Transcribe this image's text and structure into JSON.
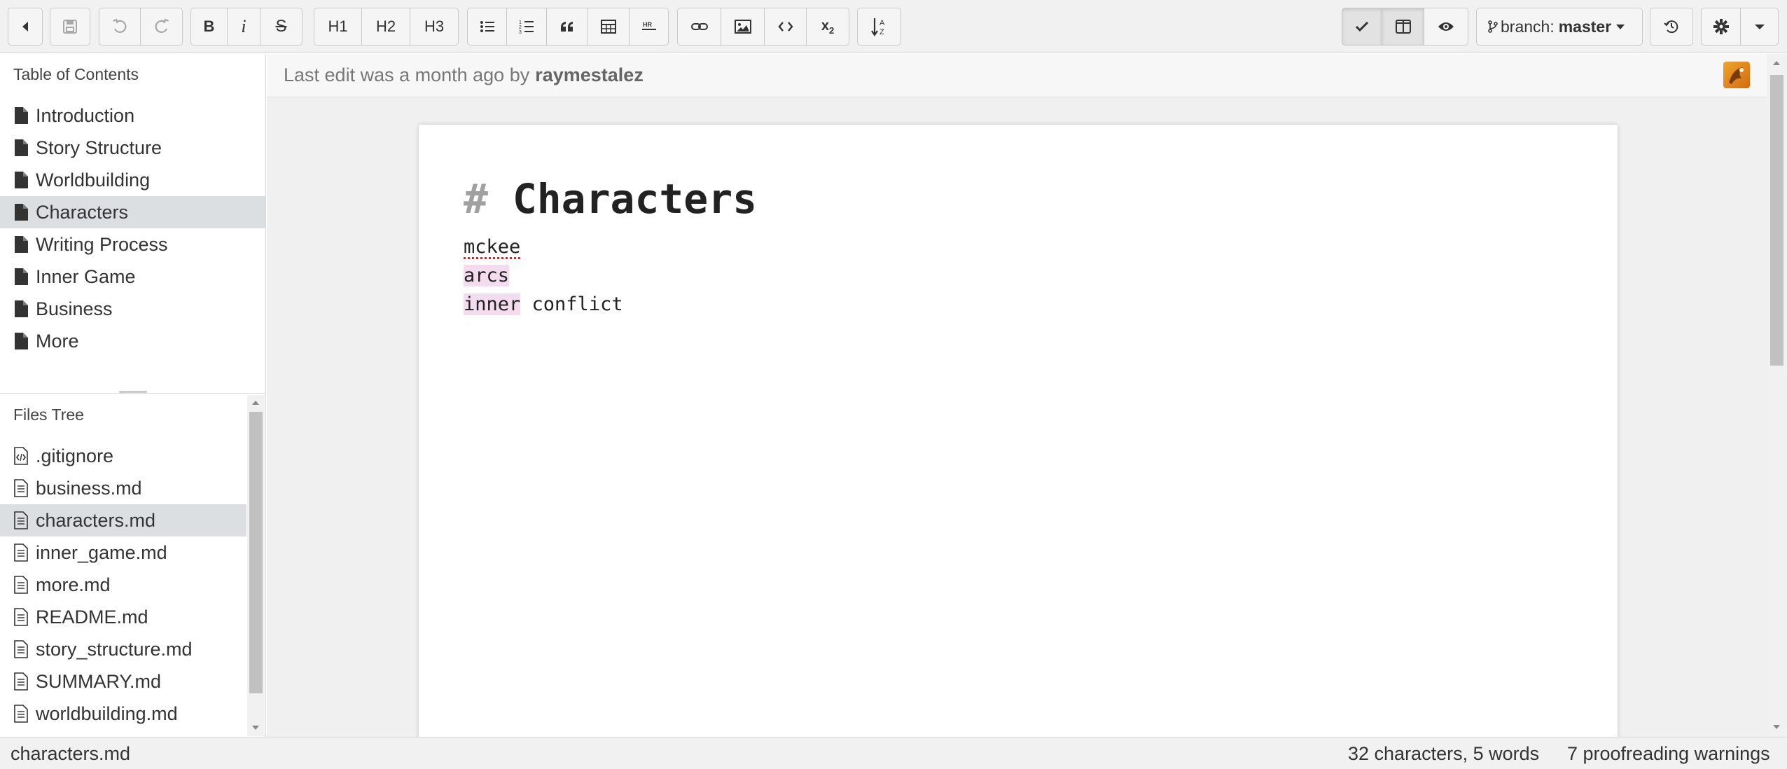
{
  "toolbar": {
    "headings": [
      "H1",
      "H2",
      "H3"
    ],
    "branch_label": "branch:",
    "branch_name": "master",
    "icons": {
      "back": "triangle-left-icon",
      "save": "floppy-disk-icon",
      "undo": "undo-icon",
      "redo": "redo-icon",
      "bold": "bold-icon",
      "italic": "italic-icon",
      "strikethrough": "strikethrough-icon",
      "bullet_list": "bullet-list-icon",
      "numbered_list": "numbered-list-icon",
      "quote": "quote-icon",
      "table": "table-icon",
      "horizontal_rule": "horizontal-rule-icon",
      "link": "link-icon",
      "image": "image-icon",
      "code": "code-icon",
      "subscript": "subscript-icon",
      "sort": "sort-az-icon",
      "check": "checkmark-icon",
      "split": "split-view-icon",
      "preview": "eye-icon",
      "git": "git-branch-icon",
      "history": "history-icon",
      "settings": "gear-icon",
      "menu": "caret-down-icon"
    }
  },
  "toc": {
    "title": "Table of Contents",
    "items": [
      "Introduction",
      "Story Structure",
      "Worldbuilding",
      "Characters",
      "Writing Process",
      "Inner Game",
      "Business",
      "More"
    ],
    "selected": "Characters"
  },
  "files": {
    "title": "Files Tree",
    "items": [
      ".gitignore",
      "business.md",
      "characters.md",
      "inner_game.md",
      "more.md",
      "README.md",
      "story_structure.md",
      "SUMMARY.md",
      "worldbuilding.md"
    ],
    "selected": "characters.md"
  },
  "info": {
    "prefix": "Last edit was a month ago by",
    "author": "raymestalez"
  },
  "editor": {
    "heading_marker": "#",
    "heading_text": "Characters",
    "line1": "mckee",
    "line2": "arcs",
    "line3_highlight": "inner",
    "line3_rest": " conflict"
  },
  "status": {
    "filename": "characters.md",
    "counts": "32 characters, 5 words",
    "warnings": "7 proofreading warnings"
  },
  "colors": {
    "selection": "#dcdfe2",
    "highlight": "#f4dcef",
    "spell_underline": "#dd2222",
    "toolbar_bg": "#f1f1f1"
  }
}
